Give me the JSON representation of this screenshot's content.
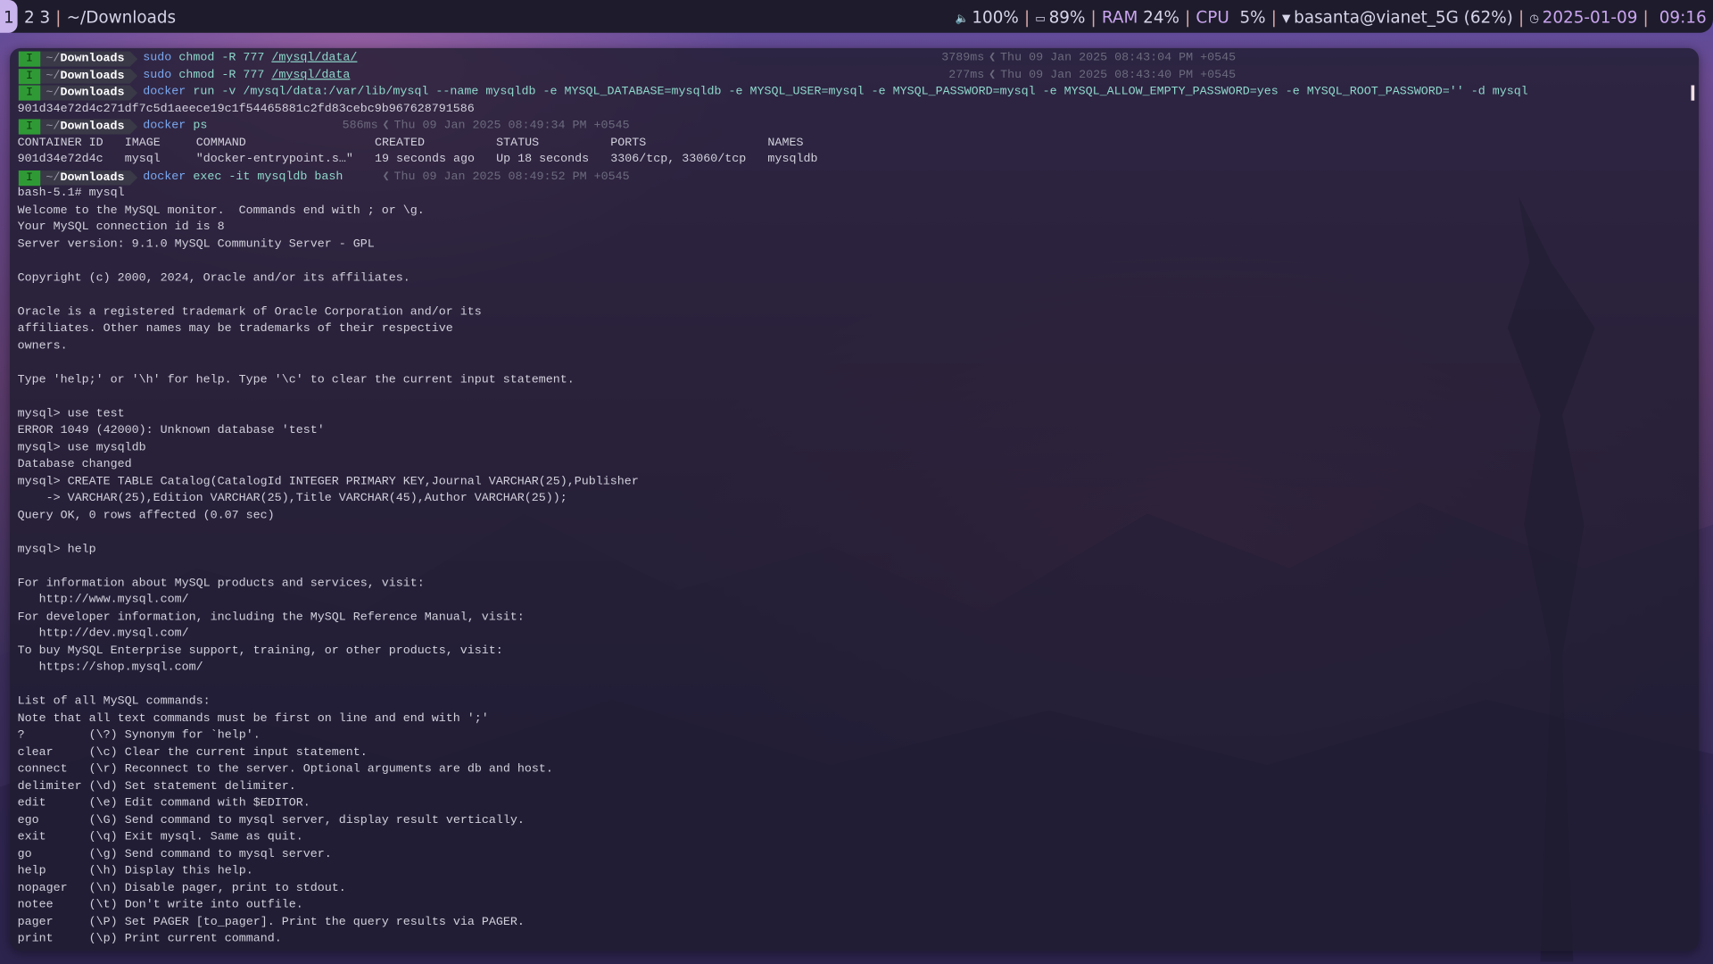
{
  "topbar": {
    "workspaces": [
      "1",
      "2",
      "3"
    ],
    "active_workspace": "1",
    "separator": "|",
    "window_title": "~/Downloads",
    "volume": {
      "icon": "speaker-icon",
      "value": "100%"
    },
    "battery": {
      "icon": "battery-icon",
      "value": "89%"
    },
    "ram": {
      "label": "RAM",
      "value": "24%"
    },
    "cpu": {
      "label": "CPU",
      "value": "5%"
    },
    "wifi": {
      "icon": "wifi-icon",
      "value": "basanta@vianet_5G (62%)"
    },
    "date": {
      "icon": "clock-icon",
      "value": "2025-01-09"
    },
    "time": "09:16",
    "accent_color": "#c9a4ee"
  },
  "terminal": {
    "prompts": [
      {
        "mode": "I",
        "dir_prefix": "~/",
        "dir": "Downloads",
        "cmd": "sudo",
        "args": " chmod -R 777 ",
        "path": "/mysql/data/",
        "duration": "3789ms",
        "timestamp": "Thu 09 Jan 2025 08:43:04 PM +0545"
      },
      {
        "mode": "I",
        "dir_prefix": "~/",
        "dir": "Downloads",
        "cmd": "sudo",
        "args": " chmod -R 777 ",
        "path": "/mysql/data",
        "duration": "277ms",
        "timestamp": "Thu 09 Jan 2025 08:43:40 PM +0545"
      },
      {
        "mode": "I",
        "dir_prefix": "~/",
        "dir": "Downloads",
        "cmd": "docker",
        "args": " run -v /mysql/data:/var/lib/mysql --name mysqldb -e MYSQL_DATABASE=mysqldb -e MYSQL_USER=mysql -e MYSQL_PASSWORD=mysql -e MYSQL_ALLOW_EMPTY_PASSWORD=yes -e MYSQL_ROOT_PASSWORD='' -d mysql",
        "path": "",
        "duration": "",
        "timestamp": ""
      },
      {
        "mode": "I",
        "dir_prefix": "~/",
        "dir": "Downloads",
        "cmd": "docker",
        "args": " ps",
        "path": "",
        "duration": "586ms",
        "timestamp": "Thu 09 Jan 2025 08:49:34 PM +0545"
      },
      {
        "mode": "I",
        "dir_prefix": "~/",
        "dir": "Downloads",
        "cmd": "docker",
        "args": " exec -it mysqldb bash",
        "path": "",
        "duration": "",
        "timestamp": "Thu 09 Jan 2025 08:49:52 PM +0545"
      }
    ],
    "container_hash": "901d34e72d4c271df7c5d1aeece19c1f54465881c2fd83cebc9b967628791586",
    "docker_ps": {
      "headers": [
        "CONTAINER ID",
        "IMAGE",
        "COMMAND",
        "CREATED",
        "STATUS",
        "PORTS",
        "NAMES"
      ],
      "rows": [
        [
          "901d34e72d4c",
          "mysql",
          "\"docker-entrypoint.s…\"",
          "19 seconds ago",
          "Up 18 seconds",
          "3306/tcp, 33060/tcp",
          "mysqldb"
        ]
      ]
    },
    "session": [
      "bash-5.1# mysql",
      "Welcome to the MySQL monitor.  Commands end with ; or \\g.",
      "Your MySQL connection id is 8",
      "Server version: 9.1.0 MySQL Community Server - GPL",
      "",
      "Copyright (c) 2000, 2024, Oracle and/or its affiliates.",
      "",
      "Oracle is a registered trademark of Oracle Corporation and/or its",
      "affiliates. Other names may be trademarks of their respective",
      "owners.",
      "",
      "Type 'help;' or '\\h' for help. Type '\\c' to clear the current input statement.",
      "",
      "mysql> use test",
      "ERROR 1049 (42000): Unknown database 'test'",
      "mysql> use mysqldb",
      "Database changed",
      "mysql> CREATE TABLE Catalog(CatalogId INTEGER PRIMARY KEY,Journal VARCHAR(25),Publisher",
      "    -> VARCHAR(25),Edition VARCHAR(25),Title VARCHAR(45),Author VARCHAR(25));",
      "Query OK, 0 rows affected (0.07 sec)",
      "",
      "mysql> help",
      "",
      "For information about MySQL products and services, visit:",
      "   http://www.mysql.com/",
      "For developer information, including the MySQL Reference Manual, visit:",
      "   http://dev.mysql.com/",
      "To buy MySQL Enterprise support, training, or other products, visit:",
      "   https://shop.mysql.com/",
      "",
      "List of all MySQL commands:",
      "Note that all text commands must be first on line and end with ';'"
    ],
    "help_commands": [
      {
        "name": "?",
        "shortcut": "(\\?)",
        "desc": "Synonym for `help'."
      },
      {
        "name": "clear",
        "shortcut": "(\\c)",
        "desc": "Clear the current input statement."
      },
      {
        "name": "connect",
        "shortcut": "(\\r)",
        "desc": "Reconnect to the server. Optional arguments are db and host."
      },
      {
        "name": "delimiter",
        "shortcut": "(\\d)",
        "desc": "Set statement delimiter."
      },
      {
        "name": "edit",
        "shortcut": "(\\e)",
        "desc": "Edit command with $EDITOR."
      },
      {
        "name": "ego",
        "shortcut": "(\\G)",
        "desc": "Send command to mysql server, display result vertically."
      },
      {
        "name": "exit",
        "shortcut": "(\\q)",
        "desc": "Exit mysql. Same as quit."
      },
      {
        "name": "go",
        "shortcut": "(\\g)",
        "desc": "Send command to mysql server."
      },
      {
        "name": "help",
        "shortcut": "(\\h)",
        "desc": "Display this help."
      },
      {
        "name": "nopager",
        "shortcut": "(\\n)",
        "desc": "Disable pager, print to stdout."
      },
      {
        "name": "notee",
        "shortcut": "(\\t)",
        "desc": "Don't write into outfile."
      },
      {
        "name": "pager",
        "shortcut": "(\\P)",
        "desc": "Set PAGER [to_pager]. Print the query results via PAGER."
      },
      {
        "name": "print",
        "shortcut": "(\\p)",
        "desc": "Print current command."
      }
    ],
    "chevron": "❮"
  }
}
